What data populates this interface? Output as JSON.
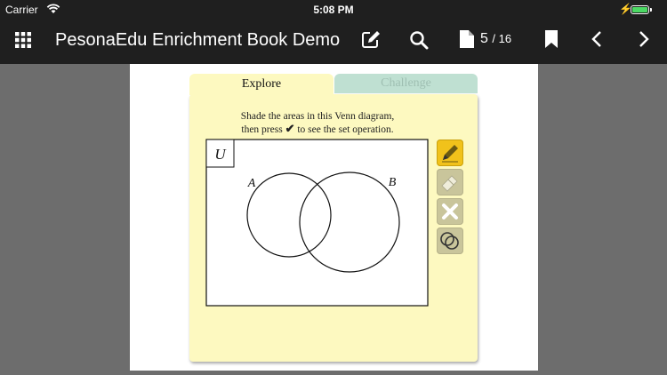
{
  "status": {
    "carrier": "Carrier",
    "time": "5:08 PM",
    "battery_level": 1.0
  },
  "navbar": {
    "title": "PesonaEdu Enrichment Book Demo",
    "page_current": "5",
    "page_total": "/ 16",
    "icons": [
      "grid-icon",
      "edit-icon",
      "search-icon",
      "page-icon",
      "bookmark-icon",
      "chevron-left-icon",
      "chevron-right-icon"
    ]
  },
  "exercise": {
    "tabs": {
      "explore": "Explore",
      "challenge": "Challenge"
    },
    "instruction_line1": "Shade the areas in this Venn diagram,",
    "instruction_line2a": "then press",
    "instruction_check": "✔",
    "instruction_line2b": "to see the set operation.",
    "universe_label": "U",
    "set_a_label": "A",
    "set_b_label": "B",
    "tools": [
      "pencil-tool",
      "eraser-tool",
      "clear-tool",
      "venn-check-tool"
    ]
  },
  "colors": {
    "card": "#fdf9c0",
    "challenge_tab": "#bfe0d2",
    "tool_active": "#f1c21b",
    "tool_inactive": "#c9c59b"
  }
}
